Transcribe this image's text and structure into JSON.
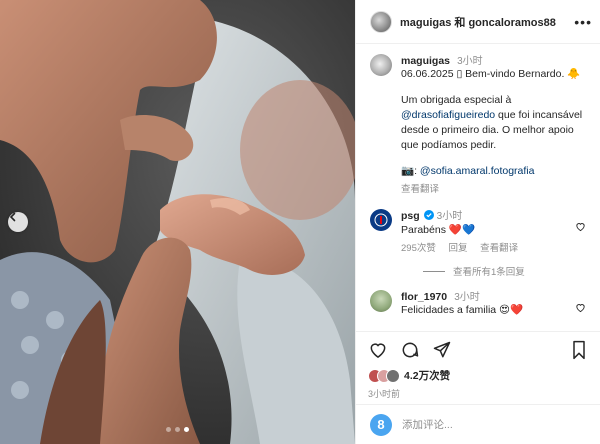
{
  "header": {
    "title": "maguigas 和 goncaloramos88",
    "more_icon": "more-horizontal-icon"
  },
  "photo": {
    "prev_icon": "chevron-left-icon",
    "slide_count": 3,
    "active_slide": 2
  },
  "caption": {
    "username": "maguigas",
    "time": "3小时",
    "line1": "06.06.2025 ▯ Bem-vindo Bernardo. 🐥",
    "line2_prefix": "Um obrigada especial à ",
    "mention": "@drasofiafigueiredo",
    "line2_suffix": " que foi incansável desde o primeiro dia. O melhor apoio que podíamos pedir.",
    "camera": "📷: ",
    "photo_credit": "@sofia.amaral.fotografia",
    "translate": "查看翻译"
  },
  "comments": [
    {
      "username": "psg",
      "verified": true,
      "time": "3小时",
      "text": "Parabéns ❤️💙",
      "likes": "295次赞",
      "reply": "回复",
      "translate": "查看翻译",
      "view_replies": "查看所有1条回复"
    },
    {
      "username": "flor_1970",
      "verified": false,
      "time": "3小时",
      "text": "Felicidades a familia 😍❤️"
    }
  ],
  "actions": {
    "like_icon": "heart-icon",
    "comment_icon": "comment-icon",
    "share_icon": "share-icon",
    "save_icon": "bookmark-icon",
    "likes_count": "4.2万次赞",
    "posted_time": "3小时前"
  },
  "add_comment": {
    "avatar_letter": "8",
    "placeholder": "添加评论..."
  },
  "colors": {
    "link": "#00376b",
    "muted": "#8e8e8e",
    "heart_red": "#ed4956",
    "verified_blue": "#0095f6",
    "psg_blue": "#0a3a85"
  }
}
